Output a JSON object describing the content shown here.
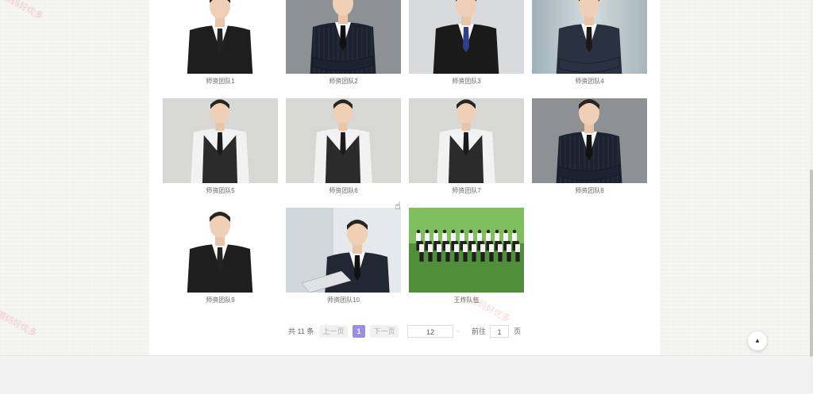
{
  "gallery": {
    "items": [
      {
        "caption": "师资团队1",
        "type": "suit-hand"
      },
      {
        "caption": "师资团队2",
        "type": "pinstripe"
      },
      {
        "caption": "师资团队3",
        "type": "suit-bluetie"
      },
      {
        "caption": "师资团队4",
        "type": "suit-glass"
      },
      {
        "caption": "师资团队5",
        "type": "vest"
      },
      {
        "caption": "师资团队6",
        "type": "vest"
      },
      {
        "caption": "师资团队7",
        "type": "vest"
      },
      {
        "caption": "师资团队8",
        "type": "pinstripe"
      },
      {
        "caption": "师资团队9",
        "type": "suit-hand"
      },
      {
        "caption": "师资团队10",
        "type": "laptop"
      },
      {
        "caption": "王炸队伍",
        "type": "team"
      }
    ]
  },
  "pagination": {
    "total": "共 11 条",
    "prev": "上一页",
    "current": "1",
    "next": "下一页",
    "page_size": "12",
    "goto_prefix": "前往",
    "goto_value": "1",
    "goto_suffix": "页"
  },
  "watermark": "源码好优多",
  "icons": {
    "back_to_top": "arrow-up-icon",
    "cursor": "hand-pointer-icon"
  }
}
